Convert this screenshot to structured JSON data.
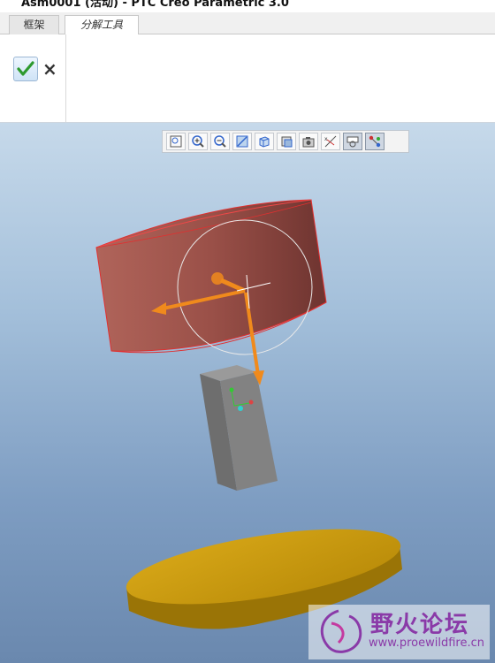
{
  "window": {
    "title": "Asm0001 (活动) - PTC Creo Parametric 3.0"
  },
  "tabs": [
    {
      "label": "框架"
    },
    {
      "label": "分解工具"
    }
  ],
  "actions": {
    "confirm_icon": "checkmark-icon",
    "cancel_label": "×"
  },
  "view_toolbar": {
    "buttons": [
      "refit-icon",
      "zoom-in-icon",
      "zoom-out-icon",
      "repaint-icon",
      "saved-views-icon",
      "display-style-icon",
      "view-manager-icon",
      "datum-display-icon",
      "spin-center-icon",
      "annotation-display-icon",
      "explode-lines-icon"
    ]
  },
  "watermark": {
    "title": "野火论坛",
    "url": "www.proewildfire.cn"
  },
  "colors": {
    "cylinder": "#a85a50",
    "disk": "#c8960e",
    "block": "#7c7c7c",
    "arrow": "#f08a1c",
    "viewport_top": "#c6d9ea",
    "viewport_bottom": "#6a88ae"
  }
}
